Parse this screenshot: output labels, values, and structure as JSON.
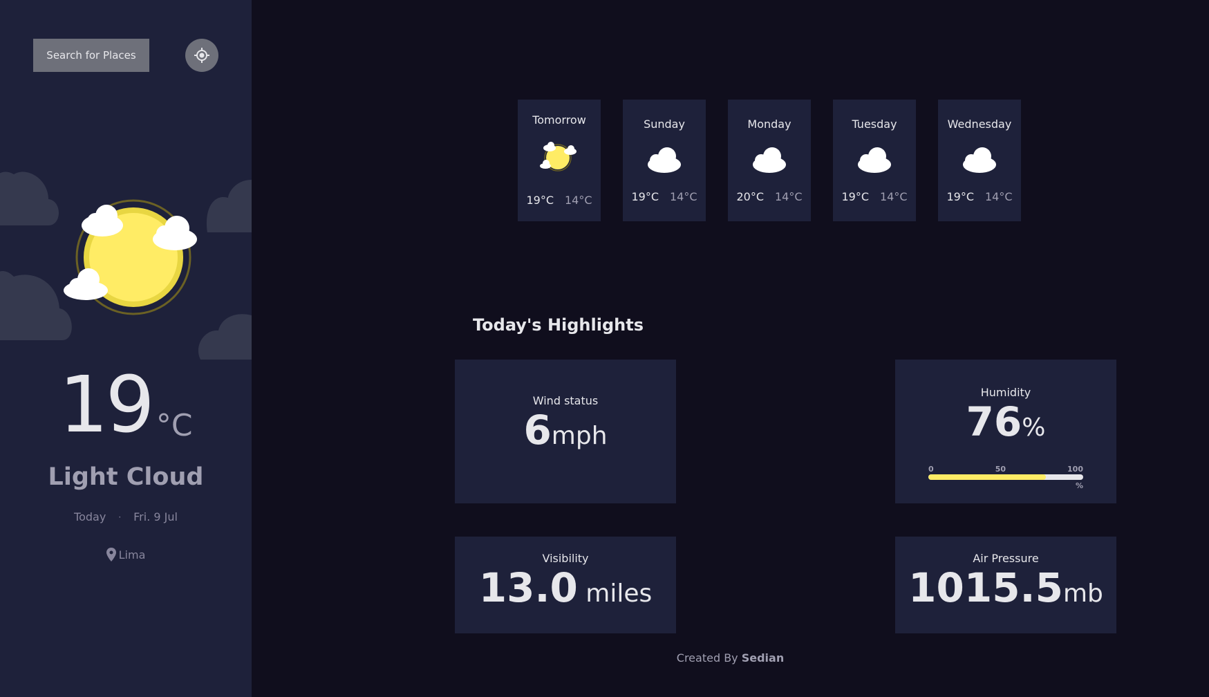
{
  "search": {
    "label": "Search for Places"
  },
  "current": {
    "temperature": "19",
    "unit": "°C",
    "condition": "Light Cloud",
    "day_label": "Today",
    "separator": "·",
    "date": "Fri. 9 Jul",
    "location": "Lima"
  },
  "forecast": [
    {
      "day": "Tomorrow",
      "max": "19°C",
      "min": "14°C",
      "icon": "light-cloud-icon"
    },
    {
      "day": "Sunday",
      "max": "19°C",
      "min": "14°C",
      "icon": "cloud-icon"
    },
    {
      "day": "Monday",
      "max": "20°C",
      "min": "14°C",
      "icon": "cloud-icon"
    },
    {
      "day": "Tuesday",
      "max": "19°C",
      "min": "14°C",
      "icon": "cloud-icon"
    },
    {
      "day": "Wednesday",
      "max": "19°C",
      "min": "14°C",
      "icon": "cloud-icon"
    }
  ],
  "highlights": {
    "title": "Today's Highlights",
    "wind": {
      "label": "Wind status",
      "value": "6",
      "unit": "mph"
    },
    "humidity": {
      "label": "Humidity",
      "value": "76",
      "unit": "%",
      "scale_min": "0",
      "scale_mid": "50",
      "scale_max": "100",
      "scale_unit": "%",
      "level": 0.76
    },
    "visibility": {
      "label": "Visibility",
      "value": "13.0",
      "unit": " miles"
    },
    "pressure": {
      "label": "Air Pressure",
      "value": "1015.5",
      "unit": "mb"
    }
  },
  "footer": {
    "prefix": "Created By ",
    "author": "Sedian"
  },
  "colors": {
    "sidebar_bg": "#1e213a",
    "main_bg": "#100e1d",
    "sun": "#ffec65",
    "text_primary": "#e7e7eb",
    "text_secondary": "#a09fb1"
  }
}
